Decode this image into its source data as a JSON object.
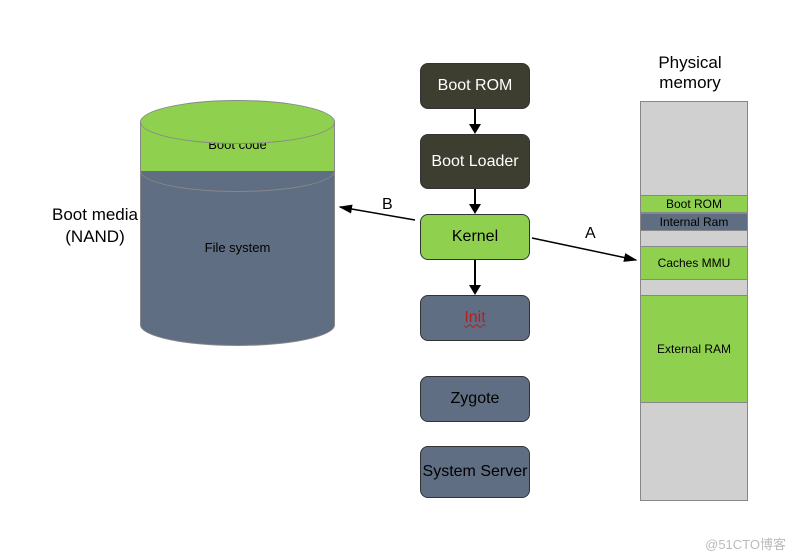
{
  "cylinder": {
    "boot_code_label": "Boot code",
    "file_system_label": "File system"
  },
  "boot_media_caption": "Boot media (NAND)",
  "flow": {
    "boot_rom": "Boot ROM",
    "boot_loader": "Boot Loader",
    "kernel": "Kernel",
    "init": "Init",
    "zygote": "Zygote",
    "system_server": "System Server"
  },
  "memory": {
    "title": "Physical memory",
    "boot_rom": "Boot ROM",
    "internal_ram": "Internal Ram",
    "caches_mmu": "Caches MMU",
    "external_ram": "External RAM"
  },
  "connectors": {
    "label_a": "A",
    "label_b": "B"
  },
  "watermark": "@51CTO博客",
  "colors": {
    "green": "#8fd14f",
    "slate": "#5f6e82",
    "dark": "#3d3d30",
    "light_gray": "#d0d0d0"
  }
}
